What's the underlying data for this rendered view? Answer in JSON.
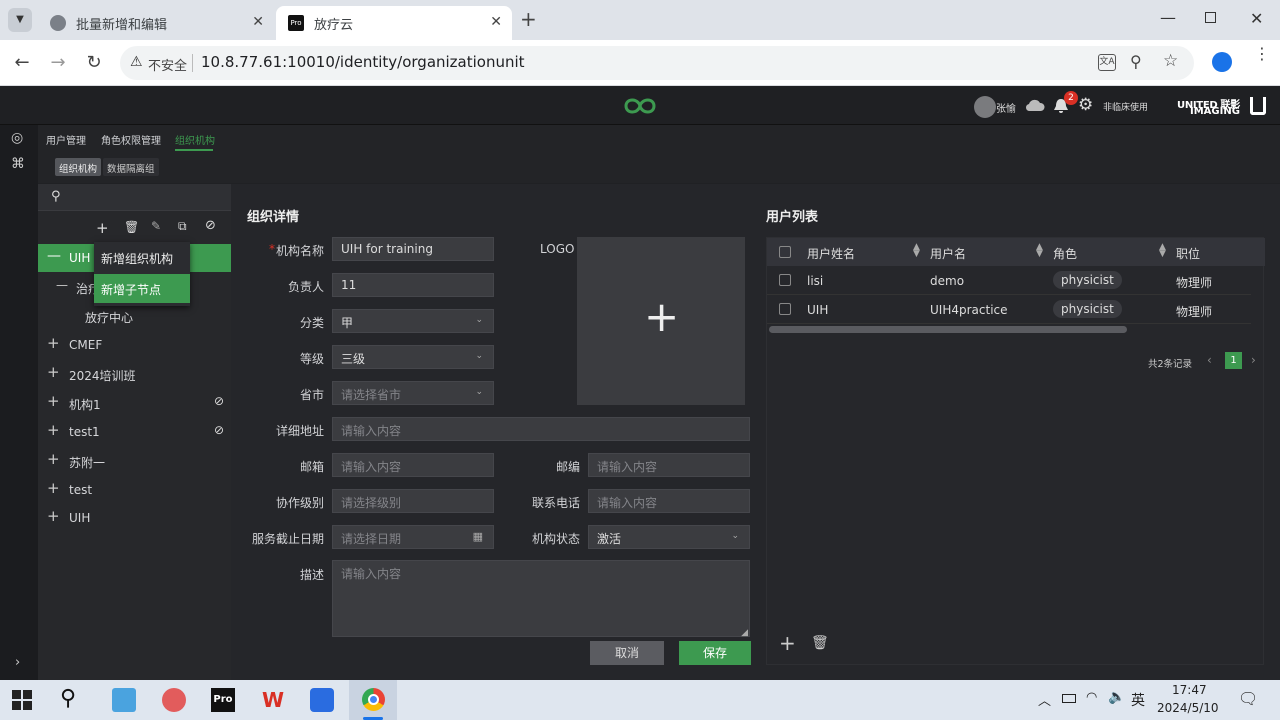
{
  "browser": {
    "tabs": [
      {
        "title": "批量新增和编辑",
        "active": false
      },
      {
        "title": "放疗云",
        "active": true
      }
    ],
    "insecure_label": "不安全",
    "url": "10.8.77.61:10010/identity/organizationunit"
  },
  "app": {
    "user_name": "张愉",
    "notification_count": "2",
    "clinical_label": "非临床使用",
    "brand_line1": "UNITED 联影",
    "brand_line2": "IMAGING"
  },
  "nav": {
    "tabs": [
      "用户管理",
      "角色权限管理",
      "组织机构"
    ],
    "active_tab": "组织机构",
    "subtabs": [
      "组织机构",
      "数据隔离组"
    ]
  },
  "tree": {
    "root_label": "UIH f",
    "context_menu": [
      "新增组织机构",
      "新增子节点"
    ],
    "child1": "治疗",
    "child2": "放疗中心",
    "items": [
      {
        "label": "CMEF",
        "disabled": false
      },
      {
        "label": "2024培训班",
        "disabled": false
      },
      {
        "label": "机构1",
        "disabled": true
      },
      {
        "label": "test1",
        "disabled": true
      },
      {
        "label": "苏附一",
        "disabled": false
      },
      {
        "label": "test",
        "disabled": false
      },
      {
        "label": "UIH",
        "disabled": false
      }
    ]
  },
  "detail": {
    "title": "组织详情",
    "labels": {
      "name": "机构名称",
      "owner": "负责人",
      "category": "分类",
      "grade": "等级",
      "province": "省市",
      "address": "详细地址",
      "email": "邮箱",
      "zipcode": "邮编",
      "coop_level": "协作级别",
      "phone": "联系电话",
      "service_end": "服务截止日期",
      "status": "机构状态",
      "desc": "描述",
      "logo": "LOGO"
    },
    "values": {
      "name": "UIH for training",
      "owner": "11",
      "category": "甲",
      "grade": "三级",
      "status": "激活"
    },
    "placeholders": {
      "province": "请选择省市",
      "address": "请输入内容",
      "email": "请输入内容",
      "zipcode": "请输入内容",
      "coop_level": "请选择级别",
      "phone": "请输入内容",
      "service_end": "请选择日期",
      "desc": "请输入内容"
    },
    "cancel_label": "取消",
    "save_label": "保存"
  },
  "users": {
    "title": "用户列表",
    "columns": [
      "用户姓名",
      "用户名",
      "角色",
      "职位"
    ],
    "rows": [
      {
        "name": "lisi",
        "username": "demo",
        "role": "physicist",
        "position": "物理师"
      },
      {
        "name": "UIH",
        "username": "UIH4practice",
        "role": "physicist",
        "position": "物理师"
      }
    ],
    "total_label": "共2条记录",
    "current_page": "1"
  },
  "taskbar": {
    "ime": "英",
    "time": "17:47",
    "date": "2024/5/10"
  },
  "colors": {
    "accent": "#3d9a50",
    "badge": "#d93025"
  }
}
